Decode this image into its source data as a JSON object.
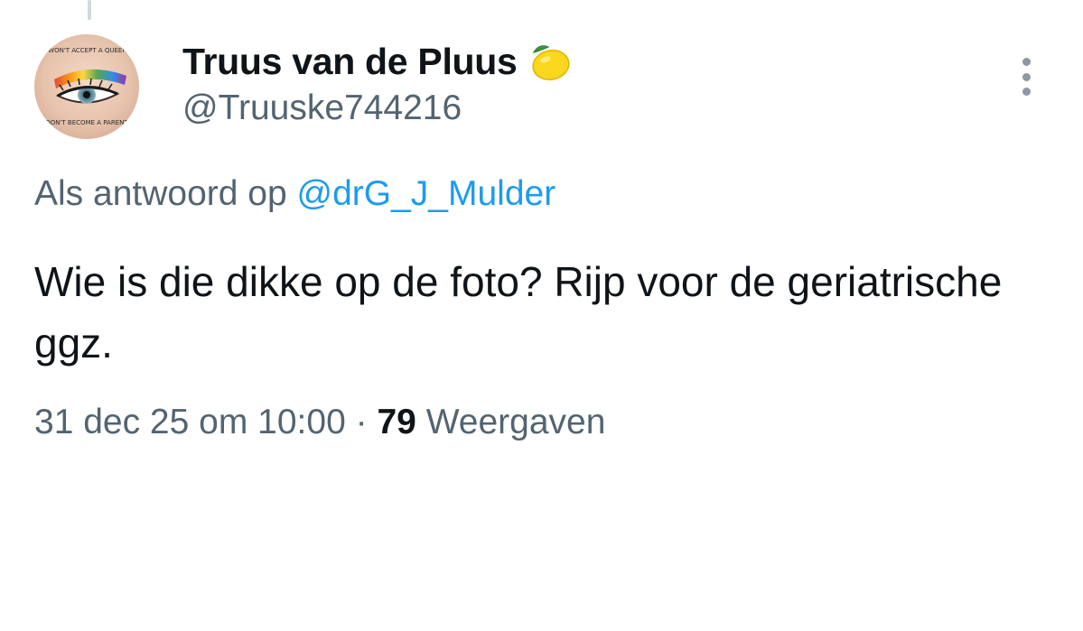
{
  "tweet": {
    "display_name": "Truus van de Pluus",
    "name_emoji": "lemon-icon",
    "handle": "@Truuske744216",
    "avatar_text": {
      "top": "IF YOU WON'T ACCEPT A QUEER CHILD",
      "bottom": "DON'T BECOME A PARENT"
    },
    "reply_prefix": "Als antwoord op",
    "reply_to": "@drG_J_Mulder",
    "text": "Wie is die dikke op de foto? Rijp voor de geriatrische ggz.",
    "timestamp": "31 dec 25 om 10:00",
    "separator": "·",
    "views_count": "79",
    "views_label": "Weergaven",
    "more_icon": "more-dots-icon"
  },
  "colors": {
    "primary_text": "#0f1419",
    "secondary_text": "#536471",
    "link": "#1d9bf0",
    "thread_line": "#cfd9de"
  }
}
